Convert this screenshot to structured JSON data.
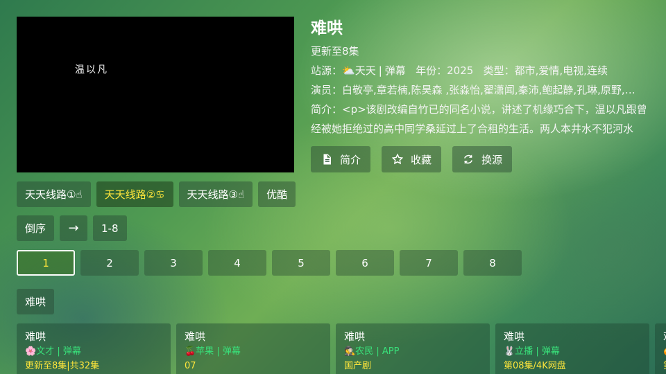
{
  "player": {
    "subtitle": "温以凡"
  },
  "detail": {
    "title": "难哄",
    "update": "更新至8集",
    "site_label": "站源：",
    "site_icon": "⛅",
    "site_name": "天天",
    "site_tag": "弹幕",
    "year_label": "年份：",
    "year": "2025",
    "type_label": "类型：",
    "type": "都市,爱情,电视,连续",
    "cast_label": "演员：",
    "cast": "白敬亭,章若楠,陈昊森 ,张淼怡,翟潇闻,秦沛,鲍起静,孔琳,原野,…",
    "desc_label": "简介：",
    "desc": "<p>该剧改编自竹已的同名小说，讲述了机缘巧合下，温以凡跟曾经被她拒绝过的高中同学桑延过上了合租的生活。两人本井水不犯河水"
  },
  "actions": [
    {
      "label": "简介",
      "icon": "document-icon"
    },
    {
      "label": "收藏",
      "icon": "star-icon"
    },
    {
      "label": "换源",
      "icon": "refresh-icon"
    }
  ],
  "lines": [
    {
      "label": "天天线路①☝",
      "active": false
    },
    {
      "label": "天天线路②♋",
      "active": true
    },
    {
      "label": "天天线路③☝",
      "active": false
    },
    {
      "label": "优酷",
      "active": false
    }
  ],
  "controls": {
    "order": "倒序",
    "arrow": "→",
    "range": "1-8"
  },
  "episodes": [
    "1",
    "2",
    "3",
    "4",
    "5",
    "6",
    "7",
    "8"
  ],
  "search_tag": "难哄",
  "results": [
    {
      "title": "难哄",
      "source": "🌸文才 | 弹幕",
      "note": "更新至8集|共32集"
    },
    {
      "title": "难哄",
      "source": "🍒苹果 | 弹幕",
      "note": "07"
    },
    {
      "title": "难哄",
      "source": "🕵农民 | APP",
      "note": "国产剧"
    },
    {
      "title": "难哄",
      "source": "🐰立播 | 弹幕",
      "note": "第08集/4K网盘"
    },
    {
      "title": "难",
      "source": "🍊",
      "note": "第"
    }
  ]
}
